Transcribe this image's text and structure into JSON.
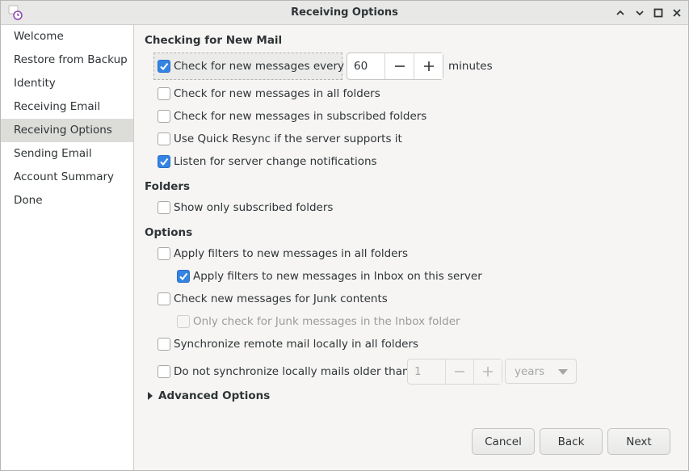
{
  "window": {
    "title": "Receiving Options",
    "controls": [
      "minimize-icon",
      "restore-icon",
      "maximize-icon",
      "close-icon"
    ]
  },
  "sidebar": {
    "items": [
      {
        "label": "Welcome",
        "selected": false
      },
      {
        "label": "Restore from Backup",
        "selected": false
      },
      {
        "label": "Identity",
        "selected": false
      },
      {
        "label": "Receiving Email",
        "selected": false
      },
      {
        "label": "Receiving Options",
        "selected": true
      },
      {
        "label": "Sending Email",
        "selected": false
      },
      {
        "label": "Account Summary",
        "selected": false
      },
      {
        "label": "Done",
        "selected": false
      }
    ]
  },
  "checking": {
    "heading": "Checking for New Mail",
    "check_every": {
      "label": "Check for new messages every",
      "checked": true,
      "value": "60",
      "unit": "minutes"
    },
    "all_folders": {
      "label": "Check for new messages in all folders",
      "checked": false
    },
    "subscribed_folders": {
      "label": "Check for new messages in subscribed folders",
      "checked": false
    },
    "quick_resync": {
      "label": "Use Quick Resync if the server supports it",
      "checked": false
    },
    "listen": {
      "label": "Listen for server change notifications",
      "checked": true
    }
  },
  "folders": {
    "heading": "Folders",
    "show_subscribed": {
      "label": "Show only subscribed folders",
      "checked": false
    }
  },
  "options": {
    "heading": "Options",
    "apply_filters_all": {
      "label": "Apply filters to new messages in all folders",
      "checked": false
    },
    "apply_filters_inbox": {
      "label": "Apply filters to new messages in Inbox on this server",
      "checked": true
    },
    "junk_check": {
      "label": "Check new messages for Junk contents",
      "checked": false
    },
    "junk_inbox_only": {
      "label": "Only check for Junk messages in the Inbox folder",
      "checked": false,
      "disabled": true
    },
    "sync_local": {
      "label": "Synchronize remote mail locally in all folders",
      "checked": false
    },
    "no_sync_older": {
      "label": "Do not synchronize locally mails older than",
      "checked": false,
      "value": "1",
      "unit": "years"
    }
  },
  "advanced": {
    "label": "Advanced Options"
  },
  "buttons": {
    "cancel": "Cancel",
    "back": "Back",
    "next": "Next"
  },
  "colors": {
    "accent": "#3584e4",
    "sidebar_selected": "#dcdcd9"
  }
}
